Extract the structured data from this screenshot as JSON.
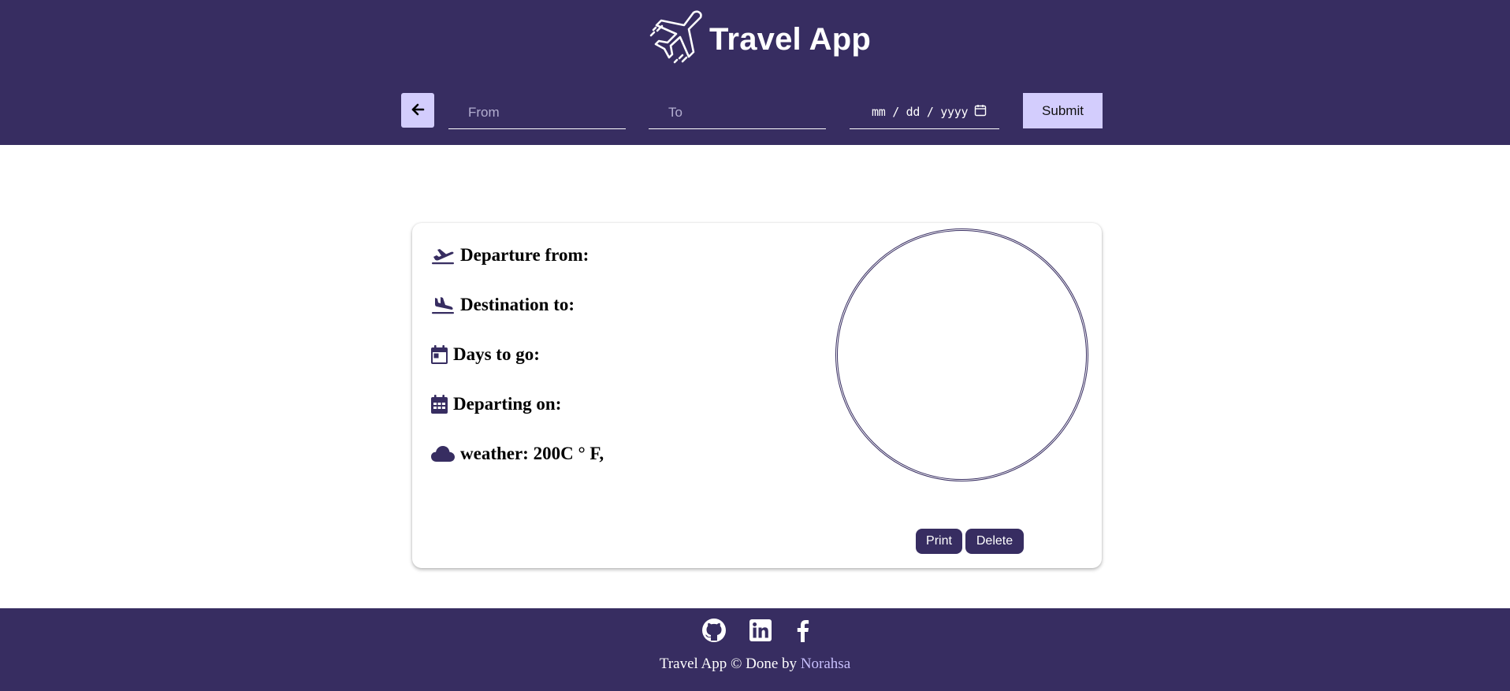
{
  "header": {
    "title": "Travel App",
    "logo_icon": "airplane-icon",
    "background": "#372d61"
  },
  "search": {
    "back_icon": "arrow-left-icon",
    "from_placeholder": "From",
    "to_placeholder": "To",
    "date_placeholder": "mm / dd / yyyy",
    "date_icon": "calendar-icon",
    "submit_label": "Submit",
    "button_color": "#d3cdfd"
  },
  "trip_card": {
    "departure_label": "Departure from:",
    "destination_label": "Destination to:",
    "days_label": "Days to go:",
    "departing_label": "Departing on:",
    "weather_label": "weather: 200C ° F,",
    "print_label": "Print",
    "delete_label": "Delete",
    "accent": "#372d61"
  },
  "footer": {
    "social_icons": [
      "github-icon",
      "linkedin-icon",
      "facebook-icon"
    ],
    "credit_text": "Travel App © Done by ",
    "author_name": "Norahsa",
    "author_color": "#c7bffd"
  }
}
